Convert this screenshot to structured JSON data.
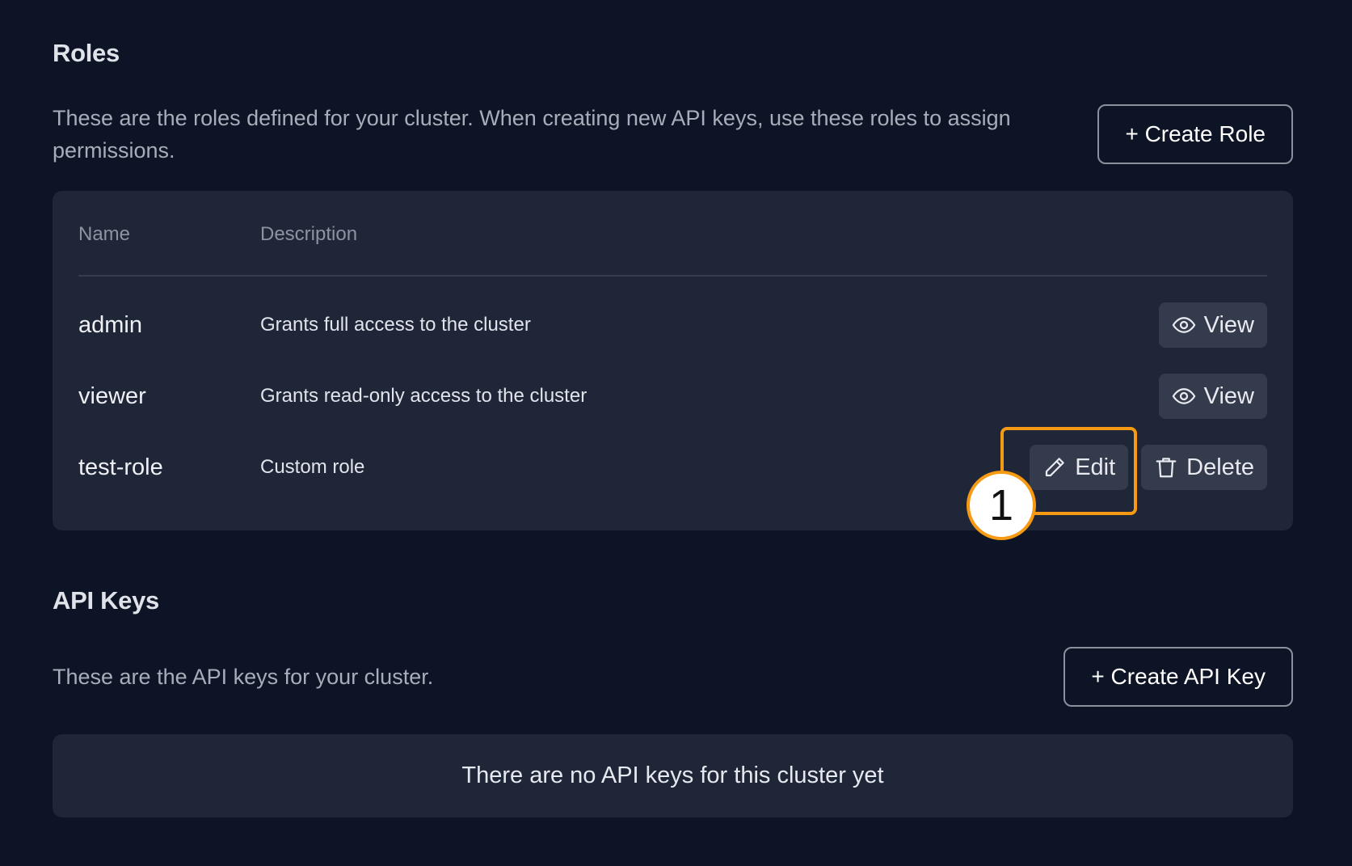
{
  "roles": {
    "title": "Roles",
    "description": "These are the roles defined for your cluster. When creating new API keys, use these roles to assign permissions.",
    "create_button": "+ Create Role",
    "columns": [
      "Name",
      "Description"
    ],
    "rows": [
      {
        "name": "admin",
        "description": "Grants full access to the cluster",
        "actions": [
          "View"
        ]
      },
      {
        "name": "viewer",
        "description": "Grants read-only access to the cluster",
        "actions": [
          "View"
        ]
      },
      {
        "name": "test-role",
        "description": "Custom role",
        "actions": [
          "Edit",
          "Delete"
        ]
      }
    ]
  },
  "api_keys": {
    "title": "API Keys",
    "description": "These are the API keys for your cluster.",
    "create_button": "+ Create API Key",
    "empty_message": "There are no API keys for this cluster yet"
  },
  "annotation": {
    "step": "1",
    "color": "#f59a12"
  },
  "icons": {
    "view": "eye-icon",
    "edit": "pencil-icon",
    "delete": "trash-icon"
  }
}
